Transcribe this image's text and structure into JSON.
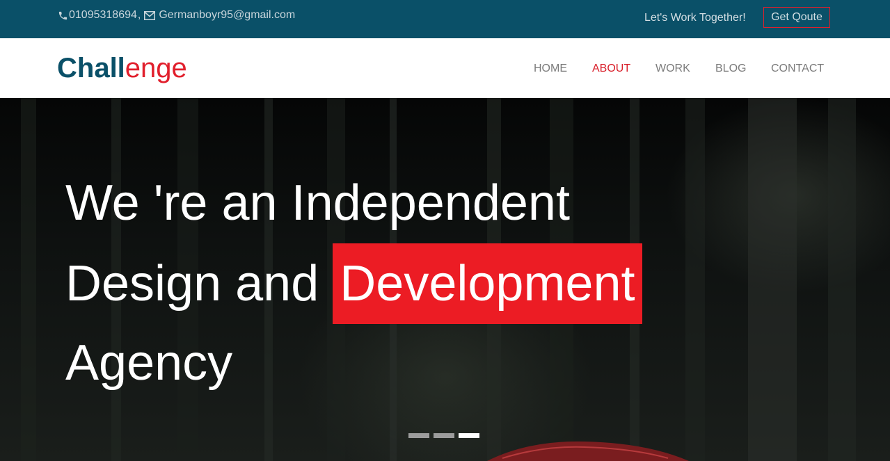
{
  "topbar": {
    "phone": "01095318694",
    "separator": ",",
    "email": "Germanboyr95@gmail.com",
    "work_together": "Let's Work Together!",
    "quote_button": "Get Qoute",
    "icons": {
      "phone": "phone-icon",
      "email": "envelope-icon"
    }
  },
  "navbar": {
    "logo_part1": "Chall",
    "logo_part2": "enge",
    "items": [
      {
        "label": "HOME",
        "active": false
      },
      {
        "label": "ABOUT",
        "active": true
      },
      {
        "label": "WORK",
        "active": false
      },
      {
        "label": "BLOG",
        "active": false
      },
      {
        "label": "CONTACT",
        "active": false
      }
    ]
  },
  "hero": {
    "line1": "We 're an Independent",
    "line2_prefix": "Design and",
    "line2_highlight": "Development",
    "line3": "Agency",
    "slider": {
      "count": 3,
      "active_index": 2
    }
  },
  "colors": {
    "topbar_bg": "#0a5068",
    "accent_red": "#ec1c24",
    "logo_blue": "#0a5068",
    "nav_text": "#7b7b7b",
    "nav_active": "#d91f2a"
  }
}
